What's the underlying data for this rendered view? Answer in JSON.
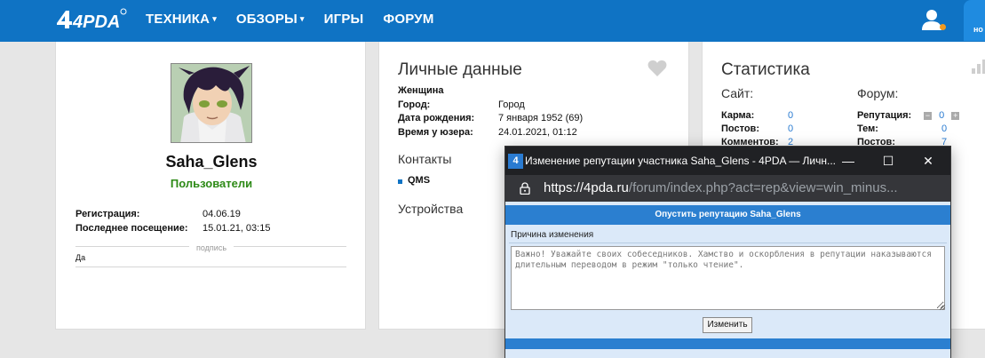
{
  "nav": {
    "logo": "4PDA",
    "items": [
      {
        "label": "ТЕХНИКА",
        "caret": "▾"
      },
      {
        "label": "ОБЗОРЫ",
        "caret": "▾"
      },
      {
        "label": "ИГРЫ",
        "caret": ""
      },
      {
        "label": "ФОРУМ",
        "caret": ""
      }
    ],
    "notif_label": "но"
  },
  "profile": {
    "username": "Saha_Glens",
    "group": "Пользователи",
    "registration_label": "Регистрация:",
    "registration_value": "04.06.19",
    "last_visit_label": "Последнее посещение:",
    "last_visit_value": "15.01.21, 03:15",
    "signature_label": "подпись",
    "signature_text": "Да"
  },
  "personal": {
    "title": "Личные данные",
    "gender": "Женщина",
    "city_label": "Город:",
    "city_value": "Город",
    "birth_label": "Дата рождения:",
    "birth_value": "7 января 1952 (69)",
    "time_label": "Время у юзера:",
    "time_value": "24.01.2021, 01:12",
    "contacts_title": "Контакты",
    "qms": "QMS",
    "devices_title": "Устройства"
  },
  "stats": {
    "title": "Статистика",
    "site_title": "Сайт:",
    "forum_title": "Форум:",
    "site": [
      {
        "label": "Карма:",
        "value": "0"
      },
      {
        "label": "Постов:",
        "value": "0"
      },
      {
        "label": "Комментов:",
        "value": "2"
      }
    ],
    "forum": [
      {
        "label": "Репутация:",
        "value": "0"
      },
      {
        "label": "Тем:",
        "value": "0"
      },
      {
        "label": "Постов:",
        "value": "7"
      }
    ],
    "minus": "−",
    "plus": "+"
  },
  "popup": {
    "title": "Изменение репутации участника Saha_Glens - 4PDA — Личн...",
    "favicon": "4",
    "btn_minimize": "—",
    "btn_maximize": "☐",
    "btn_close": "✕",
    "url_host": "https://4pda.ru",
    "url_rest": "/forum/index.php?act=rep&view=win_minus...",
    "form_header": "Опустить репутацию Saha_Glens",
    "reason_label": "Причина изменения",
    "reason_placeholder": "Важно! Уважайте своих собеседников. Хамство и оскорбления в репутации наказываются длительным переводом в режим \"только чтение\".",
    "submit_label": "Изменить"
  },
  "colors": {
    "nav_bg": "#0f73c4",
    "group_green": "#2d8a16",
    "link_blue": "#2a7bd1",
    "form_header": "#2b7fd0"
  }
}
